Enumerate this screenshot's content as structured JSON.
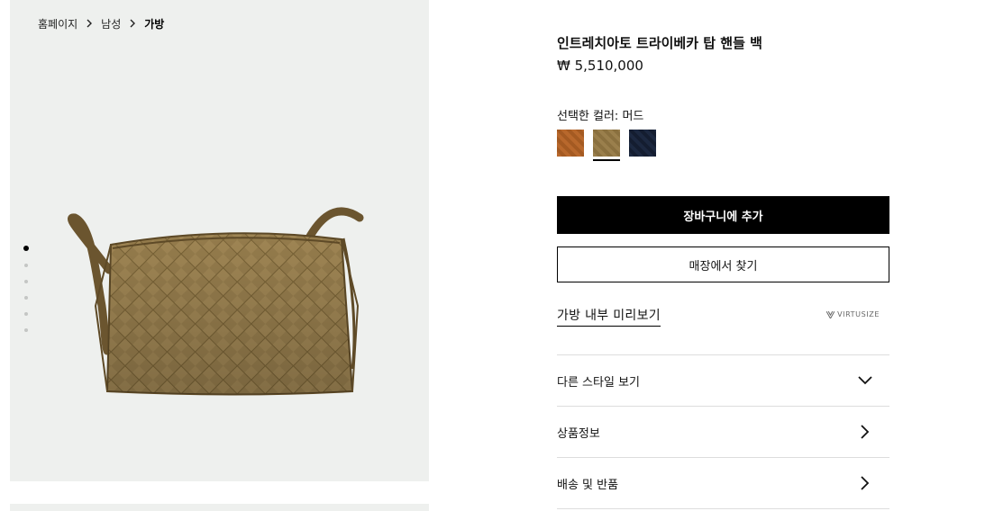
{
  "breadcrumb": {
    "home": "홈페이지",
    "category": "남성",
    "current": "가방",
    "separator": ">"
  },
  "gallery": {
    "image_count": 6,
    "active_index": 0,
    "alt": "인트레치아토 트라이베카 탑 핸들 백"
  },
  "product": {
    "title": "인트레치아토 트라이베카 탑 핸들 백",
    "price": "₩ 5,510,000",
    "selected_color_label": "선택한 컬러: 머드",
    "colors": [
      {
        "name": "color-swatch-orange",
        "hex": "#b8682c",
        "selected": false
      },
      {
        "name": "color-swatch-mud",
        "hex": "#9a7f4c",
        "selected": true
      },
      {
        "name": "color-swatch-navy",
        "hex": "#1c2840",
        "selected": false
      }
    ]
  },
  "actions": {
    "add_to_bag": "장바구니에 추가",
    "find_in_store": "매장에서 찾기",
    "preview_inside": "가방 내부 미리보기",
    "virtusize": "VIRTUSIZE"
  },
  "accordion": [
    {
      "label": "다른 스타일 보기",
      "icon": "chevron-down-icon"
    },
    {
      "label": "상품정보",
      "icon": "chevron-right-icon"
    },
    {
      "label": "배송 및 반품",
      "icon": "chevron-right-icon"
    }
  ],
  "colors": {
    "gallery_bg": "#eef0ee",
    "primary_button": "#000000",
    "divider": "#dddddd"
  }
}
